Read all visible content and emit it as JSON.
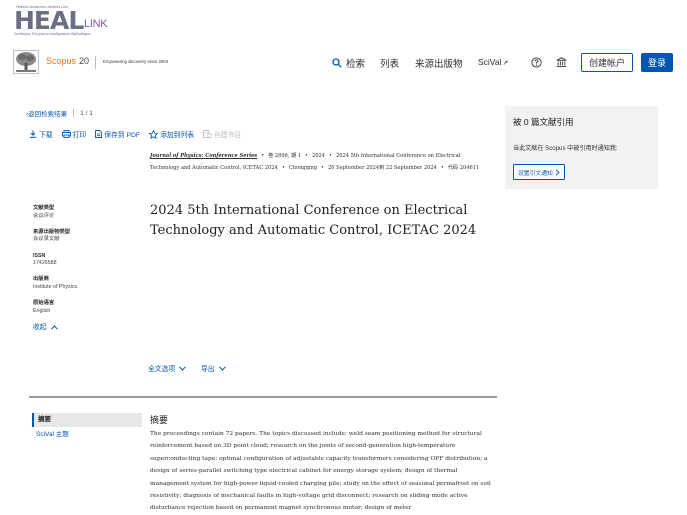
{
  "heal": {
    "tagline": "Hellenic Academic Libraries Link",
    "big": "HEAL",
    "small": "LINK",
    "subline": "Σύνδεσμος Ελληνικών Ακαδημαϊκών Βιβλιοθηκών"
  },
  "header": {
    "scopus_label": "Scopus",
    "scopus_version": "20",
    "tagline": "Empowering discovery since 2004",
    "nav": {
      "search": "检索",
      "list": "列表",
      "sources": "来源出版物",
      "scival": "SciVal",
      "scival_ext": "↗"
    },
    "create_account": "创建帐户",
    "login": "登录"
  },
  "back": {
    "label": "返回检索结果",
    "page": "1",
    "slash": "/",
    "total": "1"
  },
  "toolbar": {
    "download": "下载",
    "print": "打印",
    "save_pdf": "保存到 PDF",
    "add_list": "添加到列表",
    "create_bib": "创建书目"
  },
  "meta": {
    "journal": "Journal of Physics: Conference Series",
    "volume": "卷 2896, 期 1",
    "year": "2024",
    "conference": "2024 5th International Conference on Electrical Technology and Automatic Control, ICETAC 2024",
    "location": "Chongqing",
    "dates": "20 September 2024到 22 September 2024",
    "code_label": "代码",
    "code": "204611"
  },
  "doc_title": "2024 5th International Conference on Electrical Technology and Automatic Control, ICETAC 2024",
  "info": {
    "doc_type_label": "文献类型",
    "doc_type": "会议评论",
    "source_type_label": "来源出版物类型",
    "source_type": "会议录文献",
    "issn_label": "ISSN",
    "issn": "17426588",
    "publisher_label": "出版商",
    "publisher": "Institute of Physics",
    "language_label": "原始语言",
    "language": "English",
    "collapse": "收起"
  },
  "actions": {
    "fulltext": "全文选项",
    "export": "导出"
  },
  "sections": {
    "abstract": "摘要",
    "scival_topics": "SciVal 主题"
  },
  "abstract": {
    "heading": "摘要",
    "text": "The proceedings contain 72 papers. The topics discussed include: weld seam positioning method for structural reinforcement based on 3D point cloud; research on the joints of second-generation high-temperature superconducting tape; optimal configuration of adjustable capacity transformers considering OPF distribution; a design of series-parallel switching type electrical cabinet for energy storage system; design of thermal management system for high-power liquid-cooled charging pile; study on the effect of seasonal permafrost on soil resistivity; diagnosis of mechanical faults in high-voltage grid disconnect; research on sliding mode active disturbance rejection based on permanent magnet synchronous motor; design of meter"
  },
  "citations": {
    "title": "被 0 篇文献引用",
    "text": "当此文献在 Scopus 中被引用时通知我:",
    "button": "设置引文通知"
  },
  "colors": {
    "accent": "#0656ad",
    "scopus_orange": "#e9711c",
    "panel_bg": "#f2f2f2"
  }
}
